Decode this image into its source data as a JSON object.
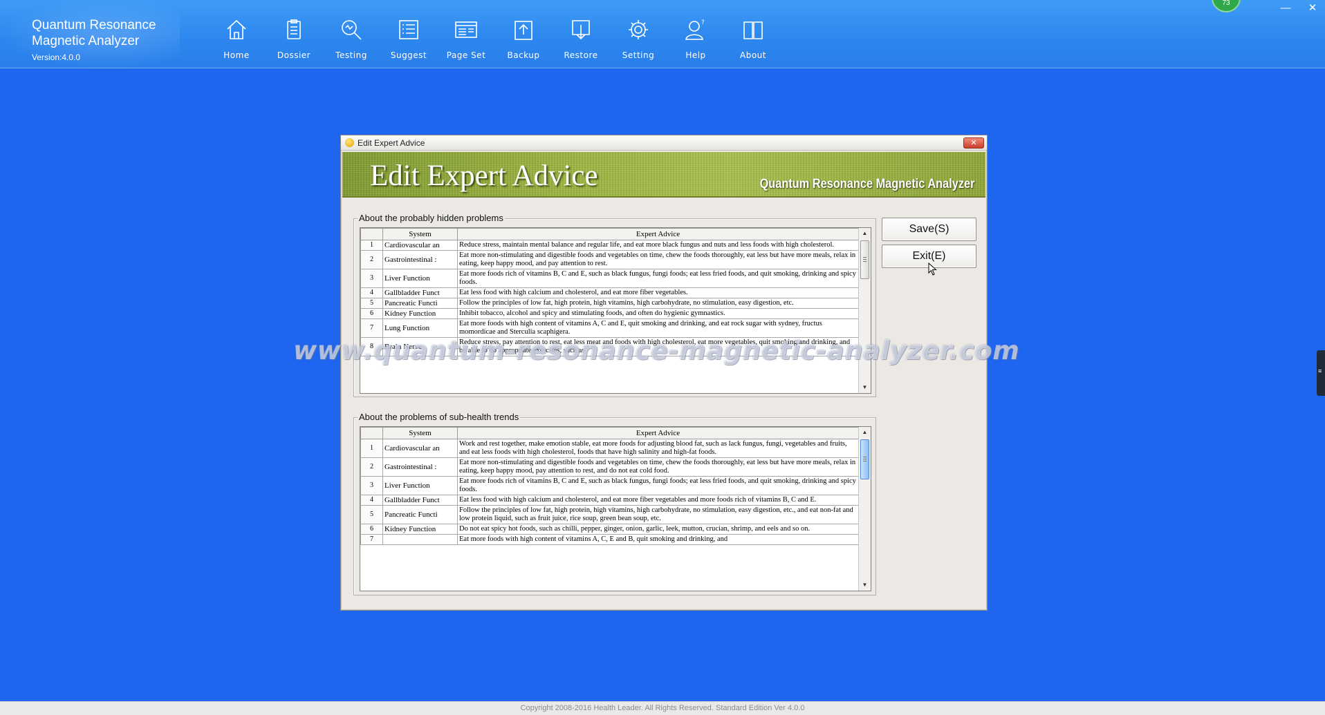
{
  "app": {
    "brand_line1": "Quantum Resonance",
    "brand_line2": "Magnetic Analyzer",
    "version": "Version:4.0.0",
    "badge": "73"
  },
  "nav": [
    {
      "label": "Home",
      "icon": "home-icon"
    },
    {
      "label": "Dossier",
      "icon": "clipboard-icon"
    },
    {
      "label": "Testing",
      "icon": "magnifier-icon"
    },
    {
      "label": "Suggest",
      "icon": "list-icon"
    },
    {
      "label": "Page Set",
      "icon": "page-icon"
    },
    {
      "label": "Backup",
      "icon": "upload-icon"
    },
    {
      "label": "Restore",
      "icon": "download-icon"
    },
    {
      "label": "Setting",
      "icon": "gear-icon"
    },
    {
      "label": "Help",
      "icon": "user-help-icon"
    },
    {
      "label": "About",
      "icon": "book-icon"
    }
  ],
  "window_controls": {
    "minimize": "—",
    "close": "✕"
  },
  "dialog": {
    "title": "Edit Expert Advice",
    "close_label": "✕",
    "banner_title": "Edit Expert Advice",
    "banner_subtitle": "Quantum Resonance Magnetic Analyzer",
    "save_label": "Save(S)",
    "exit_label": "Exit(E)",
    "columns": {
      "index": "",
      "system": "System",
      "advice": "Expert Advice"
    },
    "hidden_problems": {
      "legend": "About the probably hidden problems",
      "rows": [
        {
          "index": "1",
          "system": "Cardiovascular an",
          "advice": "Reduce stress, maintain mental balance and regular life, and eat more black fungus and nuts and less foods with high cholesterol."
        },
        {
          "index": "2",
          "system": "Gastrointestinal :",
          "advice": "Eat more non-stimulating and digestible foods and vegetables on time, chew the foods thoroughly, eat less but have more meals, relax in eating, keep happy mood, and pay attention to rest."
        },
        {
          "index": "3",
          "system": "Liver Function",
          "advice": "Eat more foods rich of vitamins B, C and E, such as black fungus, fungi foods; eat less fried foods, and quit smoking, drinking and spicy foods."
        },
        {
          "index": "4",
          "system": "Gallbladder Funct",
          "advice": "Eat less food with high calcium and cholesterol, and eat more fiber vegetables."
        },
        {
          "index": "5",
          "system": "Pancreatic Functi",
          "advice": "Follow the principles of low fat, high protein, high vitamins, high carbohydrate, no stimulation, easy digestion, etc."
        },
        {
          "index": "6",
          "system": "Kidney Function",
          "advice": "Inhibit tobacco, alcohol and spicy and stimulating foods, and often do hygienic gymnastics."
        },
        {
          "index": "7",
          "system": "Lung Function",
          "advice": "Eat more foods with high content of vitamins A, C and E, quit smoking and drinking, and eat rock sugar with sydney, fructus momordicae and Sterculia scaphigera."
        },
        {
          "index": "8",
          "system": "Brain Nerve",
          "advice": "Reduce stress, pay attention to rest, eat less meat and foods with high cholesterol, eat more vegetables, quit smoking and drinking, and be able to do appropriate exercises, such as"
        }
      ]
    },
    "subhealth_trends": {
      "legend": "About the problems of sub-health trends",
      "rows": [
        {
          "index": "1",
          "system": "Cardiovascular an",
          "advice": "Work and rest together, make emotion stable, eat more foods for adjusting blood fat, such as lack fungus, fungi, vegetables and fruits, and eat less foods with high cholesterol, foods that have high salinity and high-fat foods."
        },
        {
          "index": "2",
          "system": "Gastrointestinal :",
          "advice": "Eat more non-stimulating and digestible foods and vegetables on time, chew the foods thoroughly, eat less but have more meals, relax in eating, keep happy mood, pay attention to rest, and do not eat cold food."
        },
        {
          "index": "3",
          "system": "Liver Function",
          "advice": "Eat more foods rich of vitamins B, C and E, such as black fungus, fungi foods; eat less fried foods, and quit smoking, drinking and spicy foods."
        },
        {
          "index": "4",
          "system": "Gallbladder Funct",
          "advice": "Eat less food with high calcium and cholesterol, and eat more fiber vegetables and more foods rich of vitamins B, C and E."
        },
        {
          "index": "5",
          "system": "Pancreatic Functi",
          "advice": "Follow the principles of low fat, high protein, high vitamins, high carbohydrate, no stimulation, easy digestion, etc., and eat non-fat and low protein liquid, such as fruit juice, rice soup, green bean soup, etc."
        },
        {
          "index": "6",
          "system": "Kidney Function",
          "advice": "Do not eat spicy hot foods, such as chilli, pepper, ginger, onion, garlic, leek, mutton, crucian, shrimp, and eels and so on."
        },
        {
          "index": "7",
          "system": "",
          "advice": "Eat more foods with high content of vitamins A, C, E and B, quit smoking and drinking, and"
        }
      ]
    }
  },
  "watermark": "www.quantum-resonance-magnetic-analyzer.com",
  "footer": "Copyright 2008-2016 Health Leader. All Rights Reserved.  Standard Edition Ver 4.0.0"
}
